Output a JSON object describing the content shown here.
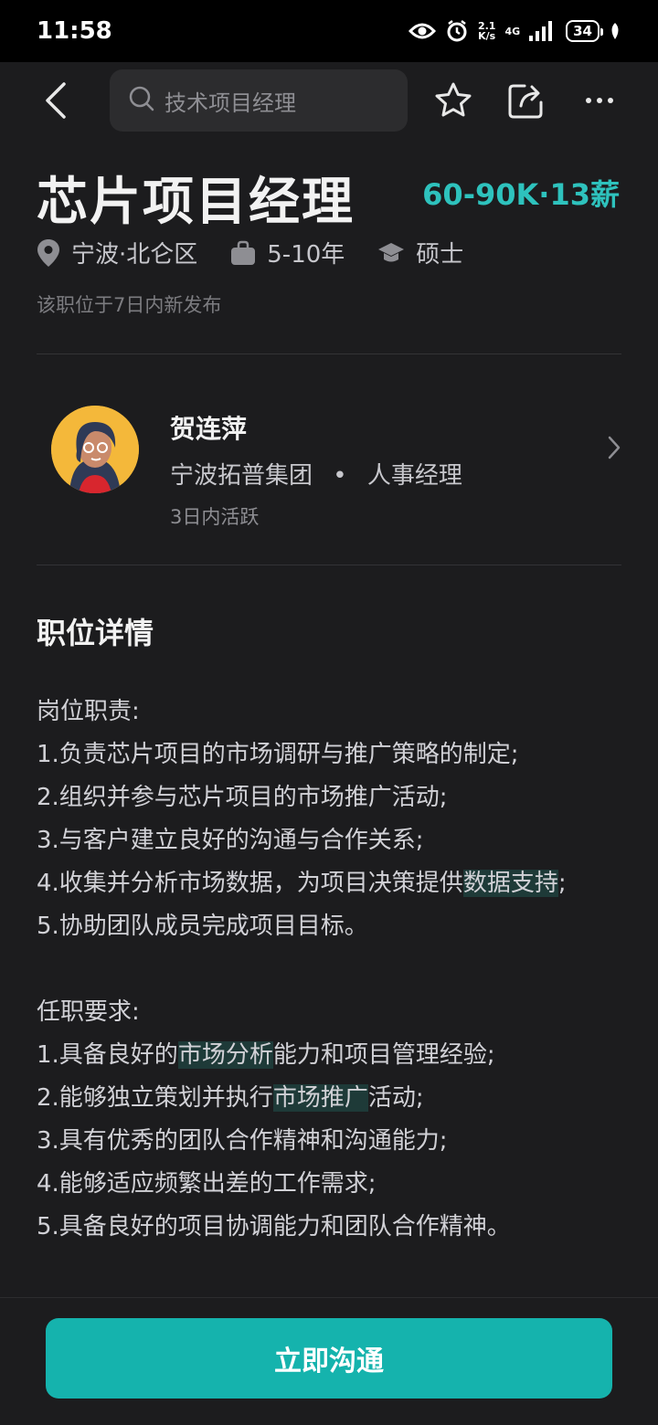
{
  "status_bar": {
    "time": "11:58",
    "speed_top": "2.1",
    "speed_bottom": "K/s",
    "network": "4G",
    "battery": "34"
  },
  "nav": {
    "search_placeholder": "技术项目经理",
    "icons": [
      "back-arrow-icon",
      "search-icon",
      "star-icon",
      "share-icon",
      "more-icon"
    ]
  },
  "job": {
    "title": "芯片项目经理",
    "salary": "60-90K·13薪",
    "location": "宁波·北仑区",
    "experience": "5-10年",
    "education": "硕士",
    "posted": "该职位于7日内新发布"
  },
  "recruiter": {
    "name": "贺连萍",
    "company": "宁波拓普集团",
    "separator": "•",
    "role": "人事经理",
    "active": "3日内活跃"
  },
  "detail": {
    "section_title": "职位详情",
    "duties_header": "岗位职责:",
    "duty_1": "1.负责芯片项目的市场调研与推广策略的制定;",
    "duty_2": "2.组织并参与芯片项目的市场推广活动;",
    "duty_3": "3.与客户建立良好的沟通与合作关系;",
    "duty_4_prefix": "4.收集并分析市场数据，为项目决策提供",
    "duty_4_highlight": "数据支持",
    "duty_4_suffix": ";",
    "duty_5": "5.协助团队成员完成项目目标。",
    "req_header": "任职要求:",
    "req_1_prefix": "1.具备良好的",
    "req_1_highlight": "市场分析",
    "req_1_suffix": "能力和项目管理经验;",
    "req_2_prefix": "2.能够独立策划并执行",
    "req_2_highlight": "市场推广",
    "req_2_suffix": "活动;",
    "req_3": "3.具有优秀的团队合作精神和沟通能力;",
    "req_4": "4.能够适应频繁出差的工作需求;",
    "req_5": "5.具备良好的项目协调能力和团队合作精神。"
  },
  "cta": {
    "label": "立即沟通"
  },
  "colors": {
    "accent": "#2ec2bd",
    "button": "#15b3ad",
    "background": "#1c1c1e"
  }
}
